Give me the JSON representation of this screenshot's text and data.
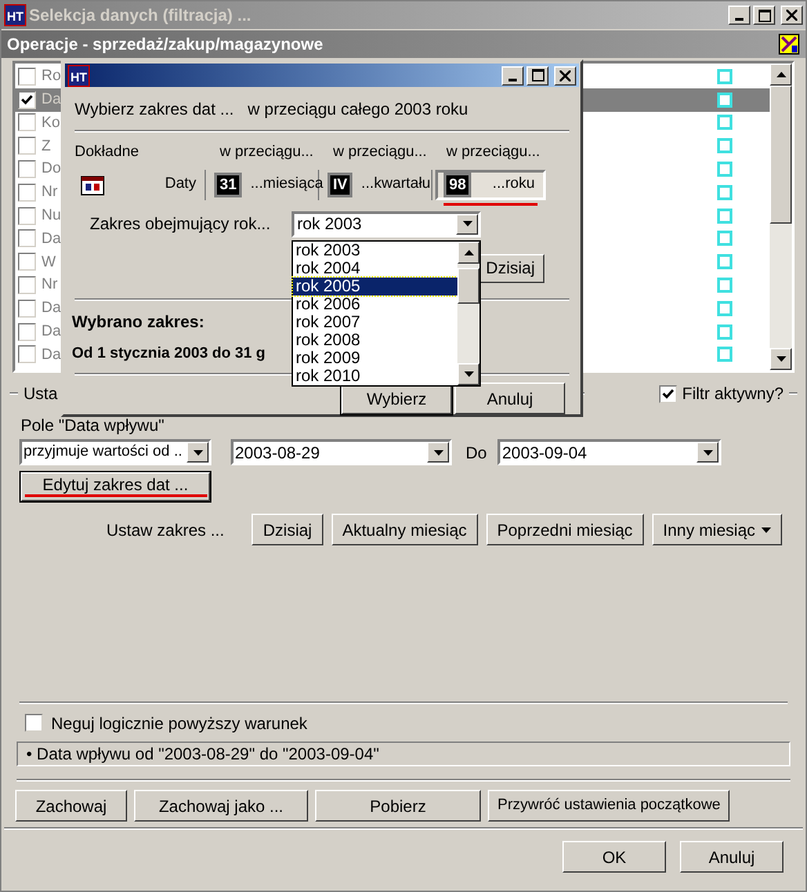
{
  "window": {
    "logo": "HT",
    "title": "Selekcja danych (filtracja) ...",
    "active": false
  },
  "header": {
    "title": "Operacje - sprzedaż/zakup/magazynowe"
  },
  "list": {
    "rows": [
      {
        "label": "Ro",
        "checked": false,
        "selected": false,
        "flag": false
      },
      {
        "label": "Da",
        "checked": true,
        "selected": true,
        "flag": false
      },
      {
        "label": "Ko",
        "checked": false,
        "selected": false,
        "flag": false
      },
      {
        "label": "Z",
        "checked": false,
        "selected": false,
        "flag": false
      },
      {
        "label": "Do",
        "checked": false,
        "selected": false,
        "flag": false
      },
      {
        "label": "Nr",
        "checked": false,
        "selected": false,
        "flag": false
      },
      {
        "label": "Nu",
        "checked": false,
        "selected": false,
        "flag": false
      },
      {
        "label": "Da",
        "checked": false,
        "selected": false,
        "flag": false
      },
      {
        "label": "W",
        "checked": false,
        "selected": false,
        "flag": false
      },
      {
        "label": "Nr",
        "checked": false,
        "selected": false,
        "flag": false
      },
      {
        "label": "Da",
        "checked": false,
        "selected": false,
        "flag": false
      },
      {
        "label": "Da",
        "checked": false,
        "selected": false,
        "flag": false
      },
      {
        "label": "Da",
        "checked": false,
        "selected": false,
        "flag": false
      }
    ]
  },
  "filter": {
    "group_label": "Usta",
    "active_label": "Filtr aktywny?",
    "active": true,
    "field_label": "Pole \"Data wpływu\"",
    "mode": "przyjmuje wartości od ..",
    "from": "2003-08-29",
    "to_label": "Do",
    "to": "2003-09-04",
    "edit_button": {
      "label": "Edytuj zakres dat ...",
      "marked": true
    },
    "range_label": "Ustaw zakres ...",
    "range_buttons": [
      {
        "label": "Dzisiaj",
        "kind": "plain"
      },
      {
        "label": "Aktualny miesiąc",
        "kind": "plain"
      },
      {
        "label": "Poprzedni miesiąc",
        "kind": "plain"
      },
      {
        "label": "Inny miesiąc",
        "kind": "menu"
      }
    ]
  },
  "negate": {
    "label": "Neguj logicznie powyższy warunek",
    "checked": false
  },
  "summary": [
    "• Data wpływu od \"2003-08-29\" do \"2003-09-04\""
  ],
  "preset_buttons": [
    "Zachowaj",
    "Zachowaj jako ...",
    "Pobierz",
    "Przywróć ustawienia początkowe"
  ],
  "dialog_buttons": [
    "OK",
    "Anuluj"
  ],
  "date_dialog": {
    "logo": "HT",
    "prompt": "Wybierz zakres dat ...",
    "prompt_detail": "w przeciągu całego 2003 roku",
    "modes": [
      {
        "kind": "calendar",
        "heading": "Dokładne",
        "label": "Daty",
        "selected": false
      },
      {
        "kind": "badge",
        "heading": "w przeciągu...",
        "badge": "31",
        "label": "...miesiąca",
        "selected": false
      },
      {
        "kind": "badge",
        "heading": "w przeciągu...",
        "badge": "IV",
        "label": "...kwartału",
        "selected": false
      },
      {
        "kind": "badge",
        "heading": "w przeciągu...",
        "badge": "98",
        "label": "...roku",
        "selected": true
      }
    ],
    "year_label": "Zakres obejmujący rok...",
    "year_value": "rok 2003",
    "year_options": [
      {
        "label": "rok 2003",
        "selected": false
      },
      {
        "label": "rok 2004",
        "selected": false
      },
      {
        "label": "rok 2005",
        "selected": true
      },
      {
        "label": "rok 2006",
        "selected": false
      },
      {
        "label": "rok 2007",
        "selected": false
      },
      {
        "label": "rok 2008",
        "selected": false
      },
      {
        "label": "rok 2009",
        "selected": false
      },
      {
        "label": "rok 2010",
        "selected": false
      }
    ],
    "today_button": "Dzisiaj",
    "result_heading": "Wybrano zakres:",
    "result": "Od 1 stycznia 2003 do 31 g",
    "buttons": [
      "Wybierz",
      "Anuluj"
    ]
  }
}
